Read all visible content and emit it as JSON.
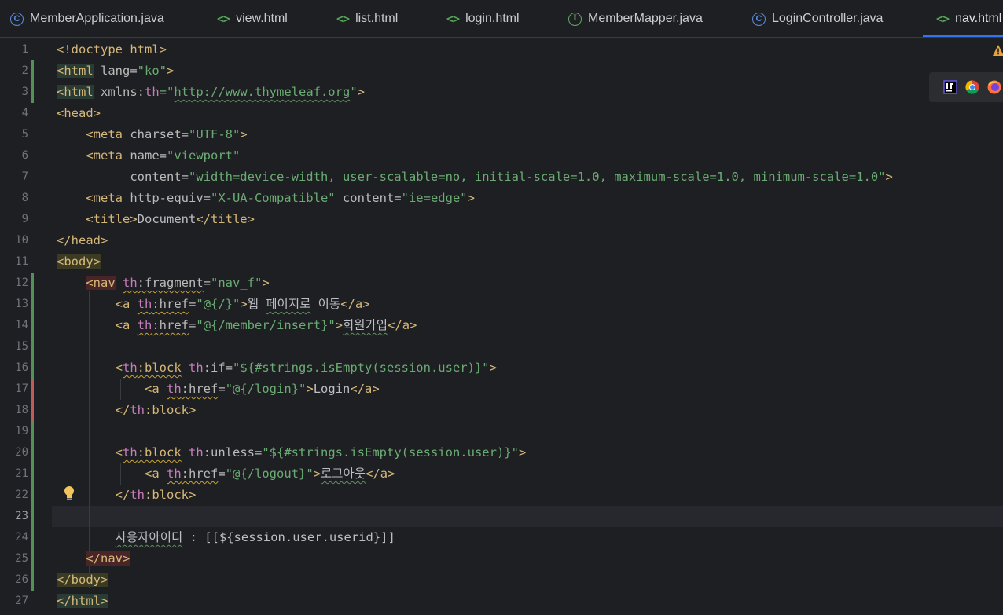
{
  "tabs": [
    {
      "label": "MemberApplication.java",
      "icon": "java-class-icon",
      "kind": "class"
    },
    {
      "label": "view.html",
      "icon": "html-file-icon",
      "kind": "html"
    },
    {
      "label": "list.html",
      "icon": "html-file-icon",
      "kind": "html"
    },
    {
      "label": "login.html",
      "icon": "html-file-icon",
      "kind": "html"
    },
    {
      "label": "MemberMapper.java",
      "icon": "java-interface-icon",
      "kind": "interface"
    },
    {
      "label": "LoginController.java",
      "icon": "java-class-icon",
      "kind": "class"
    },
    {
      "label": "nav.html",
      "icon": "html-file-icon",
      "kind": "html",
      "active": true
    }
  ],
  "editor": {
    "current_line": 23,
    "line_numbers": [
      "1",
      "2",
      "3",
      "4",
      "5",
      "6",
      "7",
      "8",
      "9",
      "10",
      "11",
      "12",
      "13",
      "14",
      "15",
      "16",
      "17",
      "18",
      "19",
      "20",
      "21",
      "22",
      "23",
      "24",
      "25",
      "26",
      "27"
    ],
    "line_text": {
      "l1_a": "<!doctype html>",
      "l2_a": "<html",
      "l2_b": " lang=",
      "l2_c": "\"ko\"",
      "l2_d": ">",
      "l3_a": "<html",
      "l3_b": " xmlns:",
      "l3_c": "th",
      "l3_d": "=\"",
      "l3_e": "http://www.thymeleaf.org",
      "l3_f": "\"",
      "l3_g": ">",
      "l4_a": "<head>",
      "l5_a": "    <meta",
      "l5_b": " charset=",
      "l5_c": "\"UTF-8\"",
      "l5_d": ">",
      "l6_a": "    <meta",
      "l6_b": " name=",
      "l6_c": "\"viewport\"",
      "l7_a": "          content=",
      "l7_b": "\"width=device-width, user-scalable=no, initial-scale=1.0, maximum-scale=1.0, minimum-scale=1.0\"",
      "l7_c": ">",
      "l8_a": "    <meta",
      "l8_b": " http-equiv=",
      "l8_c": "\"X-UA-Compatible\"",
      "l8_d": " content=",
      "l8_e": "\"ie=edge\"",
      "l8_f": ">",
      "l9_a": "    <title>",
      "l9_b": "Document",
      "l9_c": "</title>",
      "l10_a": "</head>",
      "l11_a": "<body>",
      "l12_a": "    ",
      "l12_b": "<nav",
      "l12_c": " ",
      "l12_d": "th",
      "l12_e": ":fragment",
      "l12_f": "=",
      "l12_g": "\"nav_f\"",
      "l12_h": ">",
      "l13_a": "        <a",
      "l13_b": " ",
      "l13_c": "th",
      "l13_d": ":href",
      "l13_e": "=",
      "l13_f": "\"@{/}\"",
      "l13_g": ">",
      "l13_h": "웹 ",
      "l13_i": "페이지로",
      "l13_j": " 이동",
      "l13_k": "</a>",
      "l14_a": "        <a",
      "l14_b": " ",
      "l14_c": "th",
      "l14_d": ":href",
      "l14_e": "=",
      "l14_f": "\"@{/member/insert}\"",
      "l14_g": ">",
      "l14_h": "회원가입",
      "l14_i": "</a>",
      "l16_a": "        <",
      "l16_b": "th",
      "l16_c": ":block",
      "l16_d": " ",
      "l16_e": "th",
      "l16_f": ":if=",
      "l16_g": "\"${#strings.isEmpty(session.user)}\"",
      "l16_h": ">",
      "l17_a": "            <a",
      "l17_b": " ",
      "l17_c": "th",
      "l17_d": ":href",
      "l17_e": "=",
      "l17_f": "\"@{/login}\"",
      "l17_g": ">",
      "l17_h": "Login",
      "l17_i": "</a>",
      "l18_a": "        </",
      "l18_b": "th",
      "l18_c": ":block",
      "l18_d": ">",
      "l20_a": "        <",
      "l20_b": "th",
      "l20_c": ":block",
      "l20_d": " ",
      "l20_e": "th",
      "l20_f": ":unless=",
      "l20_g": "\"${#strings.isEmpty(session.user)}\"",
      "l20_h": ">",
      "l21_a": "            <a",
      "l21_b": " ",
      "l21_c": "th",
      "l21_d": ":href",
      "l21_e": "=",
      "l21_f": "\"@{/logout}\"",
      "l21_g": ">",
      "l21_h": "로그아웃",
      "l21_i": "</a>",
      "l22_a": "        </",
      "l22_b": "th",
      "l22_c": ":block",
      "l22_d": ">",
      "l24_a": "        ",
      "l24_b": "사용자아이디",
      "l24_c": " : [[${session.user.userid}]]",
      "l25_a": "    ",
      "l25_b": "</nav>",
      "l26_a": "</body>",
      "l27_a": "</html>"
    }
  },
  "icons": {
    "intention_bulb": "lightbulb-icon",
    "warning": "warning-icon",
    "browsers": [
      "intellij-preview-icon",
      "chrome-icon",
      "firefox-icon"
    ]
  },
  "colors": {
    "background": "#1e1f22",
    "tag": "#d5b778",
    "string": "#6aab73",
    "namespace": "#c77dbb",
    "active_tab_underline": "#3574f0"
  }
}
